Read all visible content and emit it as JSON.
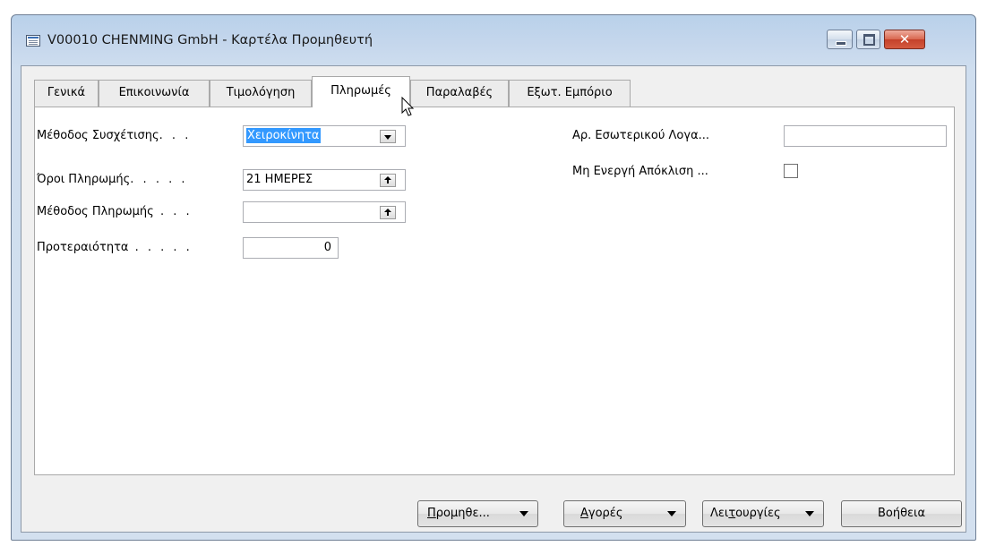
{
  "window": {
    "title": "V00010 CHENMING GmbH - Καρτέλα Προμηθευτή",
    "controls": [
      "minimize-icon",
      "maximize-icon",
      "close-icon"
    ]
  },
  "tabs": [
    {
      "label": "Γενικά",
      "active": false
    },
    {
      "label": "Επικοινωνία",
      "active": false
    },
    {
      "label": "Τιμολόγηση",
      "active": false
    },
    {
      "label": "Πληρωμές",
      "active": true
    },
    {
      "label": "Παραλαβές",
      "active": false
    },
    {
      "label": "Εξωτ. Εμπόριο",
      "active": false
    }
  ],
  "payments": {
    "application_method": {
      "label": "Μέθοδος Συσχέτισης",
      "value": "Χειροκίνητα"
    },
    "payment_terms": {
      "label": "Όροι Πληρωμής",
      "value": "21 ΗΜΕΡΕΣ"
    },
    "payment_method": {
      "label": "Μέθοδος Πληρωμής",
      "value": ""
    },
    "priority": {
      "label": "Προτεραιότητα",
      "value": "0"
    },
    "our_account_no": {
      "label": "Αρ. Εσωτερικού Λογα...",
      "value": ""
    },
    "block_payment_tolerance": {
      "label": "Μη Ενεργή Απόκλιση ...",
      "checked": false
    }
  },
  "buttons": {
    "vendor": {
      "pre": "",
      "mnemonic": "Π",
      "post": "ρομηθε..."
    },
    "purchases": {
      "pre": "",
      "mnemonic": "Α",
      "post": "γορές"
    },
    "functions": {
      "pre": "Λει",
      "mnemonic": "τ",
      "post": "ουργίες"
    },
    "help": "Βοήθεια"
  },
  "colors": {
    "selection": "#3399ff",
    "title_bar": "#c4d6ec",
    "close_button": "#c4412a"
  }
}
